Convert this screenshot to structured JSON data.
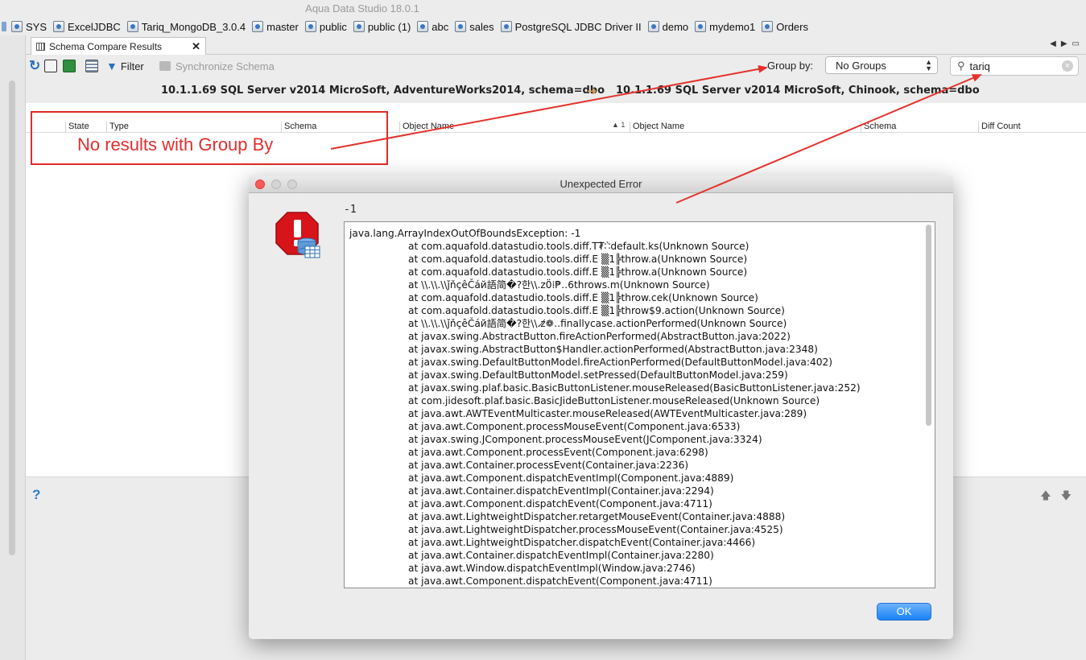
{
  "app": {
    "title": "Aqua Data Studio 18.0.1"
  },
  "bookmarks": [
    {
      "label": "SYS"
    },
    {
      "label": "ExcelJDBC"
    },
    {
      "label": "Tariq_MongoDB_3.0.4"
    },
    {
      "label": "master"
    },
    {
      "label": "public"
    },
    {
      "label": "public (1)"
    },
    {
      "label": "abc"
    },
    {
      "label": "sales"
    },
    {
      "label": "PostgreSQL JDBC Driver II"
    },
    {
      "label": "demo"
    },
    {
      "label": "mydemo1"
    },
    {
      "label": "Orders"
    }
  ],
  "tab": {
    "label": "Schema Compare Results",
    "close": "✕"
  },
  "toolbar": {
    "filter_label": "Filter",
    "sync_label": "Synchronize Schema",
    "group_by_label": "Group by:",
    "group_by_value": "No Groups",
    "search_value": "tariq"
  },
  "compare": {
    "source": "10.1.1.69 SQL Server v2014 MicroSoft, AdventureWorks2014,  schema=dbo",
    "target": "10.1.1.69 SQL Server v2014 MicroSoft, Chinook,  schema=dbo"
  },
  "grid": {
    "columns": [
      "State",
      "Type",
      "Schema",
      "Object Name",
      "Object Name",
      "Schema",
      "Diff Count"
    ],
    "sort_indicator": "▲ 1"
  },
  "annotation": {
    "text": "No results with Group By"
  },
  "dialog": {
    "title": "Unexpected Error",
    "code": "-1",
    "ok_label": "OK",
    "trace": [
      "java.lang.ArrayIndexOutOfBoundsException: -1",
      "at com.aquafold.datastudio.tools.diff.T₮̀∷̀default.ks(Unknown Source)",
      "at com.aquafold.datastudio.tools.diff.E ▒1╠throw.a(Unknown Source)",
      "at com.aquafold.datastudio.tools.diff.E ▒1╠throw.a(Unknown Source)",
      "at \\\\.\\\\.\\\\ǰňçêČáй語简�?한\\\\.z0̈⁞₱‥6throws.m(Unknown Source)",
      "at com.aquafold.datastudio.tools.diff.E ▒1╠throw.cek(Unknown Source)",
      "at com.aquafold.datastudio.tools.diff.E ▒1╠throw$9.action(Unknown Source)",
      "at \\\\.\\\\.\\\\ǰňçêČáй語简�?한\\\\.z̸❁‥finallycase.actionPerformed(Unknown Source)",
      "at javax.swing.AbstractButton.fireActionPerformed(AbstractButton.java:2022)",
      "at javax.swing.AbstractButton$Handler.actionPerformed(AbstractButton.java:2348)",
      "at javax.swing.DefaultButtonModel.fireActionPerformed(DefaultButtonModel.java:402)",
      "at javax.swing.DefaultButtonModel.setPressed(DefaultButtonModel.java:259)",
      "at javax.swing.plaf.basic.BasicButtonListener.mouseReleased(BasicButtonListener.java:252)",
      "at com.jidesoft.plaf.basic.BasicJideButtonListener.mouseReleased(Unknown Source)",
      "at java.awt.AWTEventMulticaster.mouseReleased(AWTEventMulticaster.java:289)",
      "at java.awt.Component.processMouseEvent(Component.java:6533)",
      "at javax.swing.JComponent.processMouseEvent(JComponent.java:3324)",
      "at java.awt.Component.processEvent(Component.java:6298)",
      "at java.awt.Container.processEvent(Container.java:2236)",
      "at java.awt.Component.dispatchEventImpl(Component.java:4889)",
      "at java.awt.Container.dispatchEventImpl(Container.java:2294)",
      "at java.awt.Component.dispatchEvent(Component.java:4711)",
      "at java.awt.LightweightDispatcher.retargetMouseEvent(Container.java:4888)",
      "at java.awt.LightweightDispatcher.processMouseEvent(Container.java:4525)",
      "at java.awt.LightweightDispatcher.dispatchEvent(Container.java:4466)",
      "at java.awt.Container.dispatchEventImpl(Container.java:2280)",
      "at java.awt.Window.dispatchEventImpl(Window.java:2746)",
      "at java.awt.Component.dispatchEvent(Component.java:4711)"
    ]
  },
  "colors": {
    "annotation_red": "#e02b2b",
    "ok_blue": "#1a82f7",
    "compare_arrow": "#d4a25b"
  }
}
